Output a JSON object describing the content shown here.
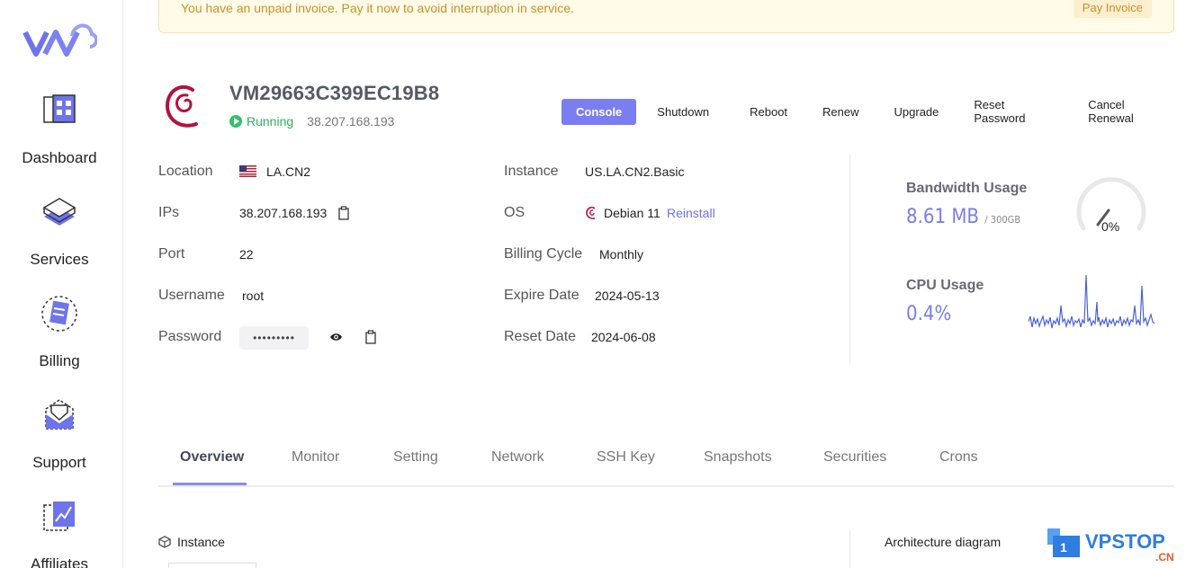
{
  "banner": {
    "text": "You have an unpaid invoice. Pay it now to avoid interruption in service.",
    "button": "Pay Invoice"
  },
  "sidebar": {
    "logo": "VM",
    "items": [
      {
        "label": "Dashboard",
        "icon": "dashboard-icon"
      },
      {
        "label": "Services",
        "icon": "services-icon"
      },
      {
        "label": "Billing",
        "icon": "billing-icon"
      },
      {
        "label": "Support",
        "icon": "support-icon"
      },
      {
        "label": "Affiliates",
        "icon": "affiliates-icon"
      }
    ]
  },
  "vm": {
    "name": "VM29663C399EC19B8",
    "status": "Running",
    "ip": "38.207.168.193"
  },
  "actions": [
    "Console",
    "Shutdown",
    "Reboot",
    "Renew",
    "Upgrade",
    "Reset Password",
    "Cancel Renewal"
  ],
  "info": {
    "location_label": "Location",
    "location_value": "LA.CN2",
    "ips_label": "IPs",
    "ips_value": "38.207.168.193",
    "port_label": "Port",
    "port_value": "22",
    "username_label": "Username",
    "username_value": "root",
    "password_label": "Password",
    "password_value": "•••••••••",
    "instance_label": "Instance",
    "instance_value": "US.LA.CN2.Basic",
    "os_label": "OS",
    "os_value": "Debian 11",
    "reinstall": "Reinstall",
    "billing_label": "Billing Cycle",
    "billing_value": "Monthly",
    "expire_label": "Expire Date",
    "expire_value": "2024-05-13",
    "reset_label": "Reset Date",
    "reset_value": "2024-06-08"
  },
  "usage": {
    "bandwidth_title": "Bandwidth Usage",
    "bandwidth_used": "8.61 MB",
    "bandwidth_total": "/ 300GB",
    "bandwidth_percent": "0%",
    "bandwidth_fraction": 0.0,
    "cpu_title": "CPU Usage",
    "cpu_value": "0.4%"
  },
  "tabs": [
    "Overview",
    "Monitor",
    "Setting",
    "Network",
    "SSH Key",
    "Snapshots",
    "Securities",
    "Crons"
  ],
  "bottom": {
    "instance_title": "Instance",
    "arch_title": "Architecture diagram"
  },
  "watermark": {
    "text": "VPSTOP",
    "sub": ".CN",
    "num": "1"
  },
  "colors": {
    "accent": "#7b7ef0",
    "running": "#31c26a",
    "banner_text": "#c7922a"
  }
}
